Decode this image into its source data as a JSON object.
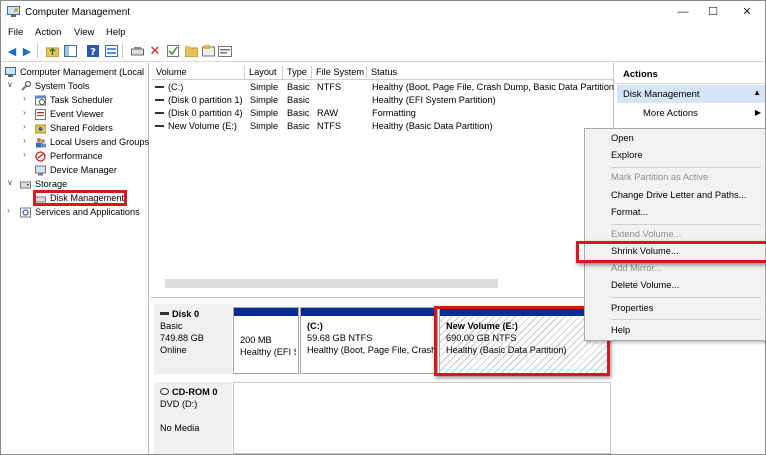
{
  "window": {
    "title": "Computer Management",
    "controls": {
      "minimize": "—",
      "maximize": "☐",
      "close": "✕"
    }
  },
  "menubar": [
    "File",
    "Action",
    "View",
    "Help"
  ],
  "toolbar_icons": [
    "back-icon",
    "forward-icon",
    "up-folder-icon",
    "show-tree-icon",
    "help-icon",
    "properties-icon",
    "connect-icon",
    "delete-icon",
    "check-icon",
    "folder-icon",
    "disk-icon",
    "console-icon"
  ],
  "tree": {
    "root": "Computer Management (Local",
    "system_tools": "System Tools",
    "task_scheduler": "Task Scheduler",
    "event_viewer": "Event Viewer",
    "shared_folders": "Shared Folders",
    "local_users": "Local Users and Groups",
    "performance": "Performance",
    "device_manager": "Device Manager",
    "storage": "Storage",
    "disk_management": "Disk Management",
    "services": "Services and Applications"
  },
  "volumes": {
    "headers": [
      "Volume",
      "Layout",
      "Type",
      "File System",
      "Status"
    ],
    "rows": [
      [
        "(C:)",
        "Simple",
        "Basic",
        "NTFS",
        "Healthy (Boot, Page File, Crash Dump, Basic Data Partition)"
      ],
      [
        "(Disk 0 partition 1)",
        "Simple",
        "Basic",
        "",
        "Healthy (EFI System Partition)"
      ],
      [
        "(Disk 0 partition 4)",
        "Simple",
        "Basic",
        "RAW",
        "Formatting"
      ],
      [
        "New Volume (E:)",
        "Simple",
        "Basic",
        "NTFS",
        "Healthy (Basic Data Partition)"
      ]
    ]
  },
  "disks": {
    "disk0": {
      "name": "Disk 0",
      "type": "Basic",
      "size": "749.88 GB",
      "state": "Online"
    },
    "partitions": [
      {
        "title": "",
        "line1": "200 MB",
        "line2": "Healthy (EFI S"
      },
      {
        "title": "(C:)",
        "line1": "59.68 GB NTFS",
        "line2": "Healthy (Boot, Page File, Crash Dump, Ba"
      },
      {
        "title": "New Volume  (E:)",
        "line1": "690.00 GB NTFS",
        "line2": "Healthy (Basic Data Partition)"
      }
    ],
    "cdrom": {
      "name": "CD-ROM 0",
      "drive": "DVD (D:)",
      "media": "No Media"
    }
  },
  "actions": {
    "header": "Actions",
    "selected": "Disk Management",
    "more": "More Actions"
  },
  "context_menu": {
    "open": "Open",
    "explore": "Explore",
    "mark_active": "Mark Partition as Active",
    "change_letter": "Change Drive Letter and Paths...",
    "format": "Format...",
    "extend": "Extend Volume...",
    "shrink": "Shrink Volume...",
    "add_mirror": "Add Mirror...",
    "delete": "Delete Volume...",
    "properties": "Properties",
    "help": "Help"
  },
  "colors": {
    "highlight_red": "#d8161e",
    "partition_bar": "#0a2a94",
    "selection": "#d3e5f6"
  }
}
